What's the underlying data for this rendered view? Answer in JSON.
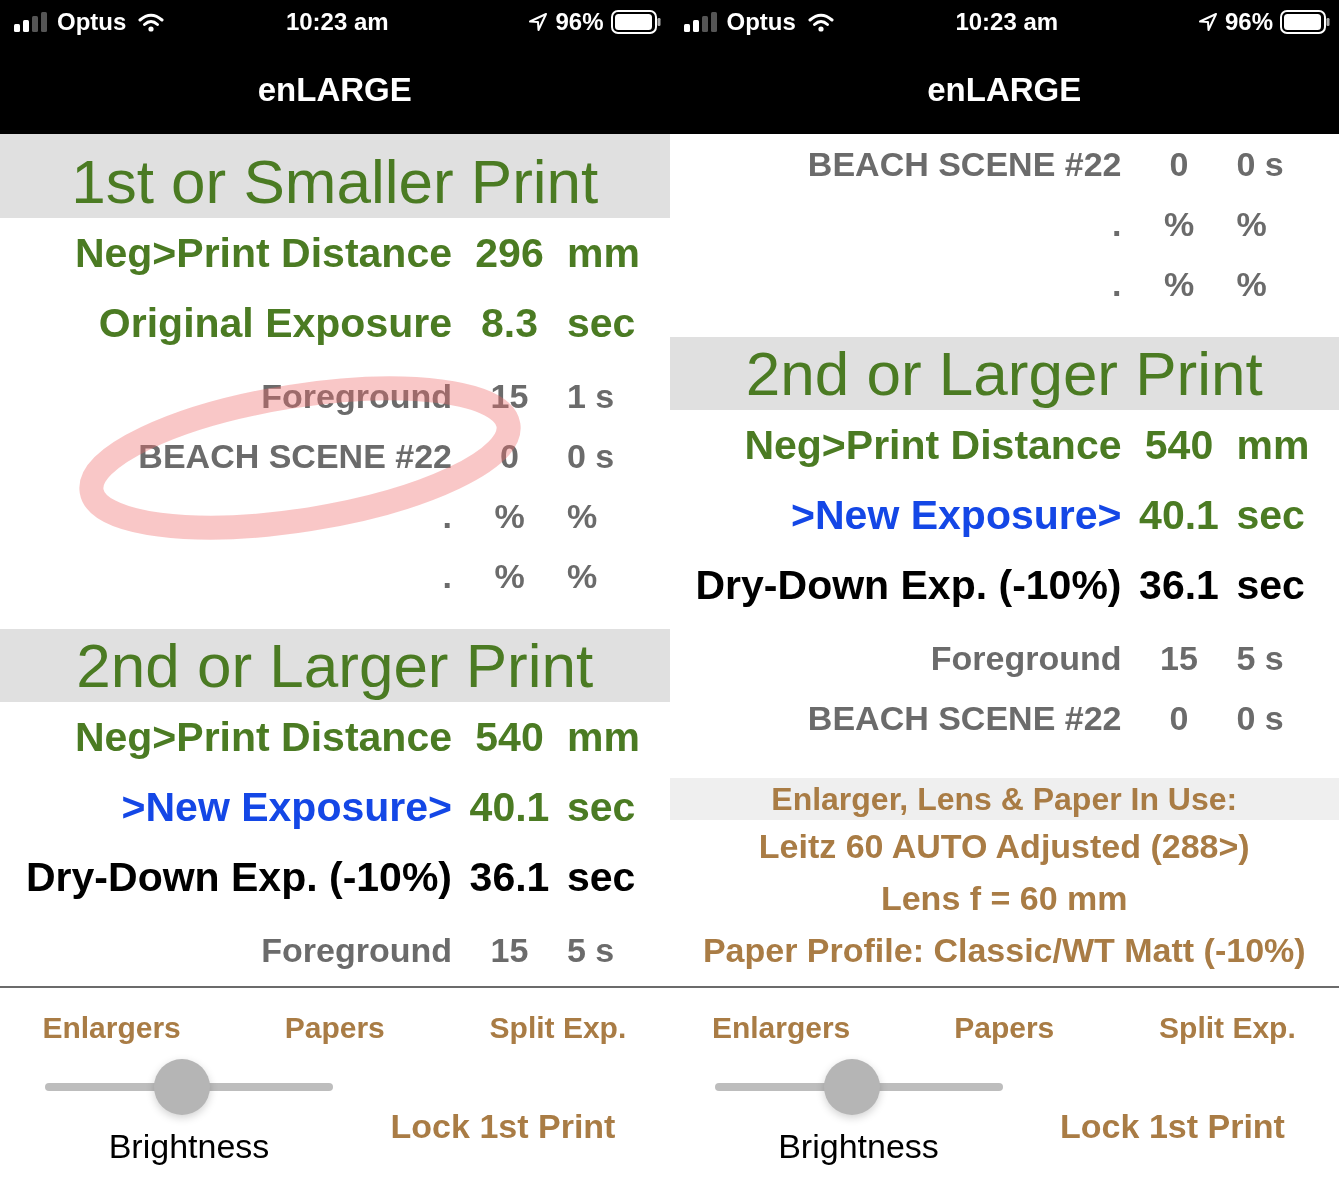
{
  "screens": [
    {
      "status_bar": {
        "carrier": "Optus",
        "time": "10:23 am",
        "battery": "96%"
      },
      "nav_title": "enLARGE",
      "content": [
        {
          "kind": "header",
          "text": "1st or Smaller Print"
        },
        {
          "kind": "setting",
          "label": "Neg>Print Distance",
          "value": "296",
          "unit": "mm"
        },
        {
          "kind": "setting",
          "label": "Original Exposure",
          "value": "8.3",
          "unit": "sec"
        },
        {
          "kind": "layer",
          "label": "Foreground",
          "value": "15",
          "unit": "1 s",
          "circled": false
        },
        {
          "kind": "layer",
          "label": "BEACH SCENE #22",
          "value": "0",
          "unit": "0 s",
          "circled": true
        },
        {
          "kind": "layer",
          "label": ".",
          "value": "%",
          "unit": "%",
          "circled": false
        },
        {
          "kind": "layer",
          "label": ".",
          "value": "%",
          "unit": "%",
          "circled": false
        },
        {
          "kind": "header",
          "text": "2nd or Larger Print"
        },
        {
          "kind": "setting",
          "label": "Neg>Print Distance",
          "value": "540",
          "unit": "mm"
        },
        {
          "kind": "result",
          "label": ">New Exposure>",
          "value": "40.1",
          "unit": "sec"
        },
        {
          "kind": "dry_down",
          "label": "Dry-Down Exp. (-10%)",
          "value": "36.1",
          "unit": "sec"
        },
        {
          "kind": "layer",
          "label": "Foreground",
          "value": "15",
          "unit": "5 s",
          "circled": false
        }
      ],
      "toolbar": {
        "buttons": [
          "Enlargers",
          "Papers",
          "Split Exp."
        ],
        "brightness": {
          "label": "Brightness",
          "level": 0.47
        },
        "lock_button": "Lock 1st Print"
      }
    },
    {
      "status_bar": {
        "carrier": "Optus",
        "time": "10:23 am",
        "battery": "96%"
      },
      "nav_title": "enLARGE",
      "content": [
        {
          "kind": "layer",
          "label": "BEACH SCENE #22",
          "value": "0",
          "unit": "0 s",
          "circled": false
        },
        {
          "kind": "layer",
          "label": ".",
          "value": "%",
          "unit": "%",
          "circled": false
        },
        {
          "kind": "layer",
          "label": ".",
          "value": "%",
          "unit": "%",
          "circled": false
        },
        {
          "kind": "header",
          "text": "2nd or Larger Print"
        },
        {
          "kind": "setting",
          "label": "Neg>Print Distance",
          "value": "540",
          "unit": "mm"
        },
        {
          "kind": "result",
          "label": ">New Exposure>",
          "value": "40.1",
          "unit": "sec"
        },
        {
          "kind": "dry_down",
          "label": "Dry-Down Exp. (-10%)",
          "value": "36.1",
          "unit": "sec"
        },
        {
          "kind": "layer",
          "label": "Foreground",
          "value": "15",
          "unit": "5 s",
          "circled": false
        },
        {
          "kind": "layer",
          "label": "BEACH SCENE #22",
          "value": "0",
          "unit": "0 s",
          "circled": false
        },
        {
          "kind": "info_header",
          "text": "Enlarger, Lens & Paper In Use:"
        },
        {
          "kind": "info",
          "text": "Leitz 60 AUTO Adjusted (288>)"
        },
        {
          "kind": "info",
          "text": "Lens f = 60 mm"
        },
        {
          "kind": "info",
          "text": "Paper Profile: Classic/WT Matt (-10%)"
        }
      ],
      "toolbar": {
        "buttons": [
          "Enlargers",
          "Papers",
          "Split Exp."
        ],
        "brightness": {
          "label": "Brightness",
          "level": 0.47
        },
        "lock_button": "Lock 1st Print"
      }
    }
  ]
}
